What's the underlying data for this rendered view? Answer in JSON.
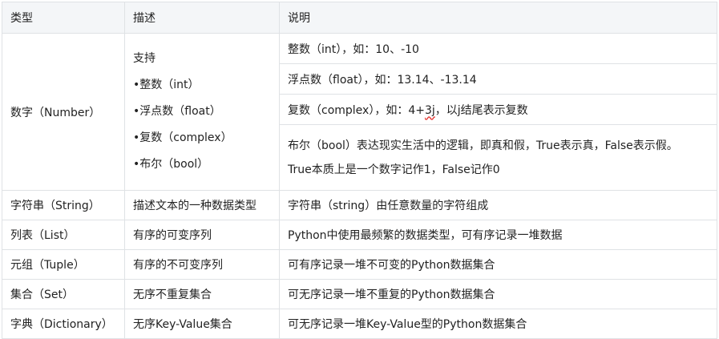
{
  "headers": {
    "type": "类型",
    "desc": "描述",
    "note": "说明"
  },
  "number": {
    "type": "数字（Number）",
    "desc_lines": [
      "支持",
      "•整数（int）",
      "•浮点数（float）",
      "•复数（complex）",
      "•布尔（bool）"
    ],
    "notes": [
      "整数（int），如：10、-10",
      "浮点数（float），如：13.14、-13.14",
      {
        "pre": "复数（complex），如：4+",
        "mark": "3j",
        "post": "，以j结尾表示复数"
      },
      [
        "布尔（bool）表达现实生活中的逻辑，即真和假，True表示真，False表示假。",
        "True本质上是一个数字记作1，False记作0"
      ]
    ]
  },
  "rows": [
    {
      "type": "字符串（String）",
      "desc": "描述文本的一种数据类型",
      "note": "字符串（string）由任意数量的字符组成"
    },
    {
      "type": "列表（List）",
      "desc": "有序的可变序列",
      "note": "Python中使用最频繁的数据类型，可有序记录一堆数据"
    },
    {
      "type": "元组（Tuple）",
      "desc": "有序的不可变序列",
      "note": "可有序记录一堆不可变的Python数据集合"
    },
    {
      "type": "集合（Set）",
      "desc": "无序不重复集合",
      "note": "可无序记录一堆不重复的Python数据集合"
    },
    {
      "type": "字典（Dictionary）",
      "desc": "无序Key-Value集合",
      "note": "可无序记录一堆Key-Value型的Python数据集合"
    }
  ]
}
